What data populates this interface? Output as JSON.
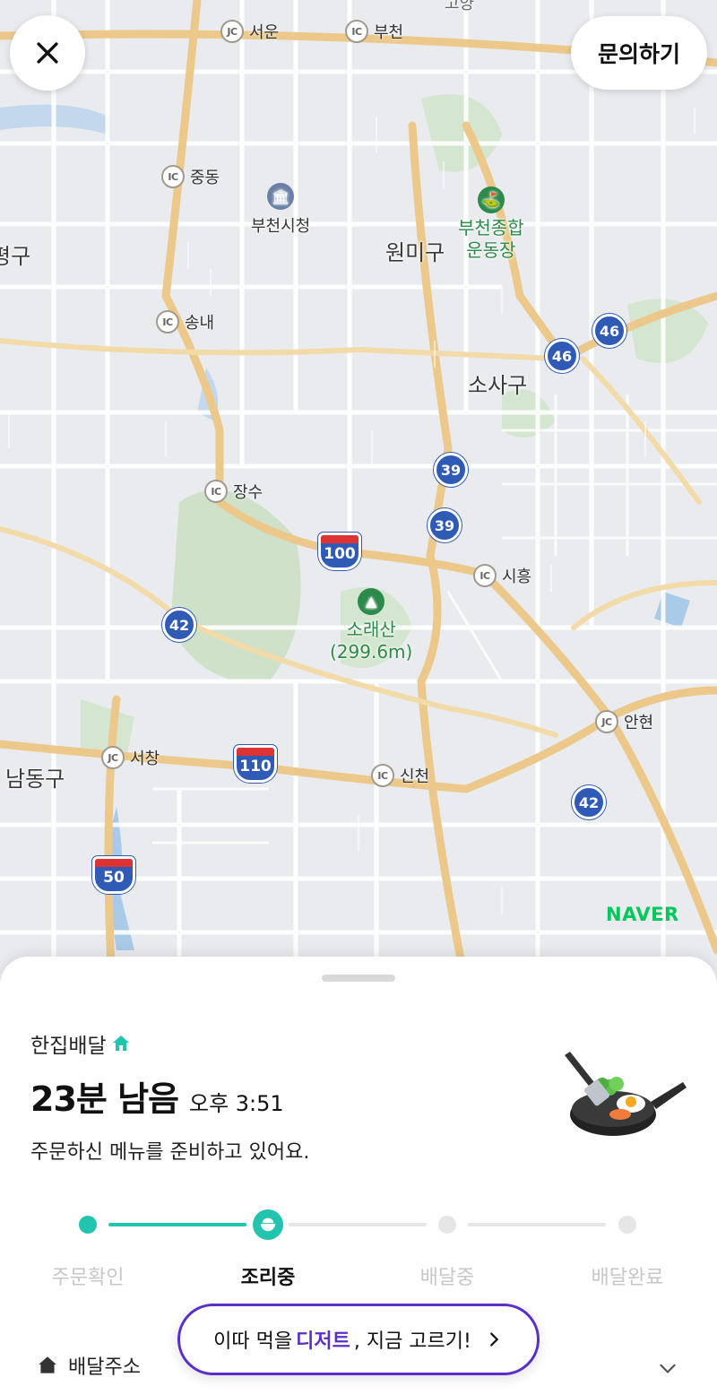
{
  "map": {
    "ic_labels": [
      {
        "kind": "JC",
        "name": "서운"
      },
      {
        "kind": "IC",
        "name": "부천"
      },
      {
        "kind": "IC",
        "name": "중동"
      },
      {
        "kind": "IC",
        "name": "송내"
      },
      {
        "kind": "IC",
        "name": "장수"
      },
      {
        "kind": "IC",
        "name": "시흥"
      },
      {
        "kind": "JC",
        "name": "안현"
      },
      {
        "kind": "JC",
        "name": "서창"
      },
      {
        "kind": "IC",
        "name": "신천"
      }
    ],
    "place_labels": {
      "bucheon_cityhall": "부천시청",
      "wonmi_gu": "원미구",
      "sosa_gu": "소사구",
      "bupyeong_gu": "평구",
      "namdong_gu": "남동구",
      "stadium_line1": "부천종합",
      "stadium_line2": "운동장",
      "mountain_name": "소래산",
      "mountain_height": "(299.6m)",
      "top_partial": "고양"
    },
    "route_numbers": [
      "46",
      "46",
      "39",
      "39",
      "42",
      "42"
    ],
    "interstate_numbers": [
      "100",
      "110",
      "50"
    ],
    "provider_logo": "NAVER"
  },
  "header": {
    "inquire_label": "문의하기"
  },
  "order": {
    "delivery_type": "한집배달",
    "remaining": "23분 남음",
    "eta_time": "오후 3:51",
    "status_message": "주문하신 메뉴를 준비하고 있어요."
  },
  "progress": {
    "steps": [
      "주문확인",
      "조리중",
      "배달중",
      "배달완료"
    ],
    "current_step_index": 1,
    "accent_color": "#22c4b0"
  },
  "address": {
    "label": "배달주소"
  },
  "promo": {
    "prefix": "이따 먹을 ",
    "highlight": "디저트",
    "suffix": ", 지금 고르기!",
    "accent_color": "#5b2ec9"
  }
}
